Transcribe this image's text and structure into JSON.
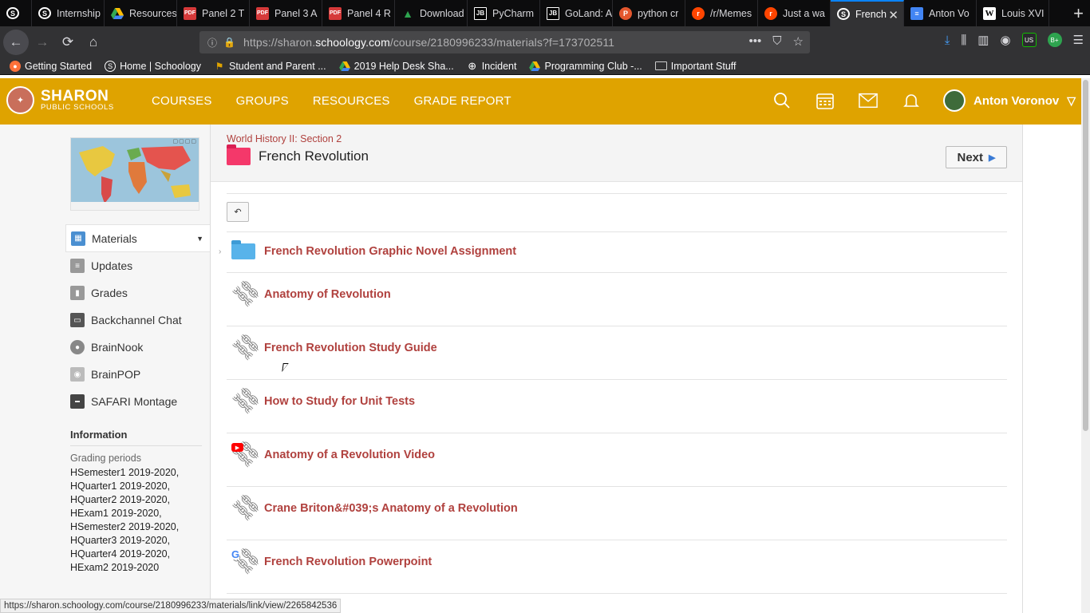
{
  "browser": {
    "tabs": [
      {
        "title": "",
        "icon": "schoology-icon",
        "fav": "S"
      },
      {
        "title": "Internship",
        "icon": "schoology-icon",
        "fav": "S"
      },
      {
        "title": "Resources",
        "icon": "google-drive-icon",
        "fav": "▲"
      },
      {
        "title": "Panel 2 T",
        "icon": "pdf-icon",
        "fav": "PDF"
      },
      {
        "title": "Panel 3 A",
        "icon": "pdf-icon",
        "fav": "PDF"
      },
      {
        "title": "Panel 4 R",
        "icon": "pdf-icon",
        "fav": "PDF"
      },
      {
        "title": "Download",
        "icon": "download-icon",
        "fav": "▲"
      },
      {
        "title": "PyCharm",
        "icon": "jetbrains-icon",
        "fav": "JB"
      },
      {
        "title": "GoLand: A",
        "icon": "jetbrains-icon",
        "fav": "JB"
      },
      {
        "title": "python cr",
        "icon": "python-icon",
        "fav": "P"
      },
      {
        "title": "/r/Memes",
        "icon": "reddit-icon",
        "fav": "r"
      },
      {
        "title": "Just a wa",
        "icon": "reddit-icon",
        "fav": "r"
      },
      {
        "title": "French",
        "icon": "schoology-icon",
        "fav": "S",
        "active": true
      },
      {
        "title": "Anton Vo",
        "icon": "google-docs-icon",
        "fav": "≡"
      },
      {
        "title": "Louis XVI",
        "icon": "wikipedia-icon",
        "fav": "W"
      }
    ],
    "url_prefix": "https://sharon.",
    "url_domain": "schoology.com",
    "url_path": "/course/2180996233/materials?f=173702511",
    "bookmarks": [
      {
        "label": "Getting Started",
        "icon": "firefox-icon"
      },
      {
        "label": "Home | Schoology",
        "icon": "schoology-icon"
      },
      {
        "label": "Student and Parent ...",
        "icon": "flag-icon"
      },
      {
        "label": "2019 Help Desk Sha...",
        "icon": "google-drive-icon"
      },
      {
        "label": "Incident",
        "icon": "globe-icon"
      },
      {
        "label": "Programming Club -...",
        "icon": "google-drive-icon"
      },
      {
        "label": "Important Stuff",
        "icon": "folder-icon"
      }
    ],
    "ext_us": "US",
    "ext_b": "B+"
  },
  "header": {
    "logo_line1": "SHARON",
    "logo_line2": "PUBLIC SCHOOLS",
    "nav": [
      "COURSES",
      "GROUPS",
      "RESOURCES",
      "GRADE REPORT"
    ],
    "user_name": "Anton Voronov"
  },
  "sidebar": {
    "items": [
      {
        "label": "Materials",
        "icon": "materials-icon",
        "active": true
      },
      {
        "label": "Updates",
        "icon": "updates-icon"
      },
      {
        "label": "Grades",
        "icon": "grades-icon"
      },
      {
        "label": "Backchannel Chat",
        "icon": "chat-icon"
      },
      {
        "label": "BrainNook",
        "icon": "brainnook-icon"
      },
      {
        "label": "BrainPOP",
        "icon": "brainpop-icon"
      },
      {
        "label": "SAFARI Montage",
        "icon": "safari-montage-icon"
      }
    ],
    "information_heading": "Information",
    "grading_label": "Grading periods",
    "grading_periods": [
      "HSemester1 2019-2020,",
      "HQuarter1 2019-2020,",
      "HQuarter2 2019-2020,",
      "HExam1 2019-2020,",
      "HSemester2 2019-2020,",
      "HQuarter3 2019-2020,",
      "HQuarter4 2019-2020,",
      "HExam2 2019-2020"
    ]
  },
  "main": {
    "breadcrumb": "World History II: Section 2",
    "folder_title": "French Revolution",
    "next_label": "Next",
    "materials": [
      {
        "label": "French Revolution Graphic Novel Assignment",
        "type": "folder"
      },
      {
        "label": "Anatomy of Revolution",
        "type": "link"
      },
      {
        "label": "French Revolution Study Guide",
        "type": "link"
      },
      {
        "label": "How to Study for Unit Tests",
        "type": "link"
      },
      {
        "label": "Anatomy of a Revolution Video",
        "type": "youtube-link"
      },
      {
        "label": "Crane Briton&#039;s Anatomy of a Revolution",
        "type": "link"
      },
      {
        "label": "French Revolution Powerpoint",
        "type": "google-link"
      }
    ]
  },
  "status_url": "https://sharon.schoology.com/course/2180996233/materials/link/view/2265842536"
}
